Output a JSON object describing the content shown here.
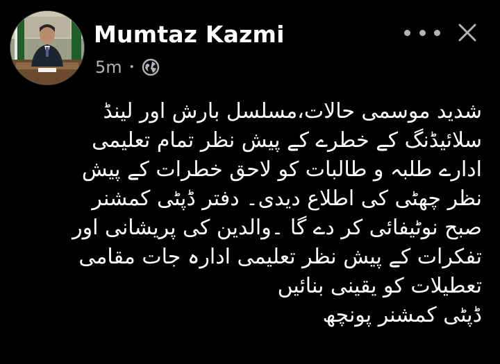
{
  "post": {
    "author": "Mumtaz Kazmi",
    "time": "5m",
    "separator": "•",
    "privacy_icon": "globe-icon",
    "more_icon": "more-horizontal-icon",
    "close_icon": "close-icon",
    "lines": [
      "شدید موسمی حالات،مسلسل بارش اور  لینڈ",
      "سلائیڈنگ کے خطرے کے پیش نظر تمام تعلیمی",
      "ادارے طلبہ و طالبات کو لاحق خطرات کے پیش",
      "نظر چھٹی کی اطلاع دیدی۔ دفتر ڈپٹی کمشنر",
      "صبح نوٹیفائی کر دے گا ۔والدین کی پریشانی اور",
      "تفکرات کے پیش نظر تعلیمی ادارہ جات مقامی",
      "تعطیلات کو یقینی بنائیں",
      "ڈپٹی کمشنر پونچھ"
    ]
  },
  "colors": {
    "background": "#000000",
    "text": "#ffffff",
    "secondary": "#b0b3b8"
  }
}
